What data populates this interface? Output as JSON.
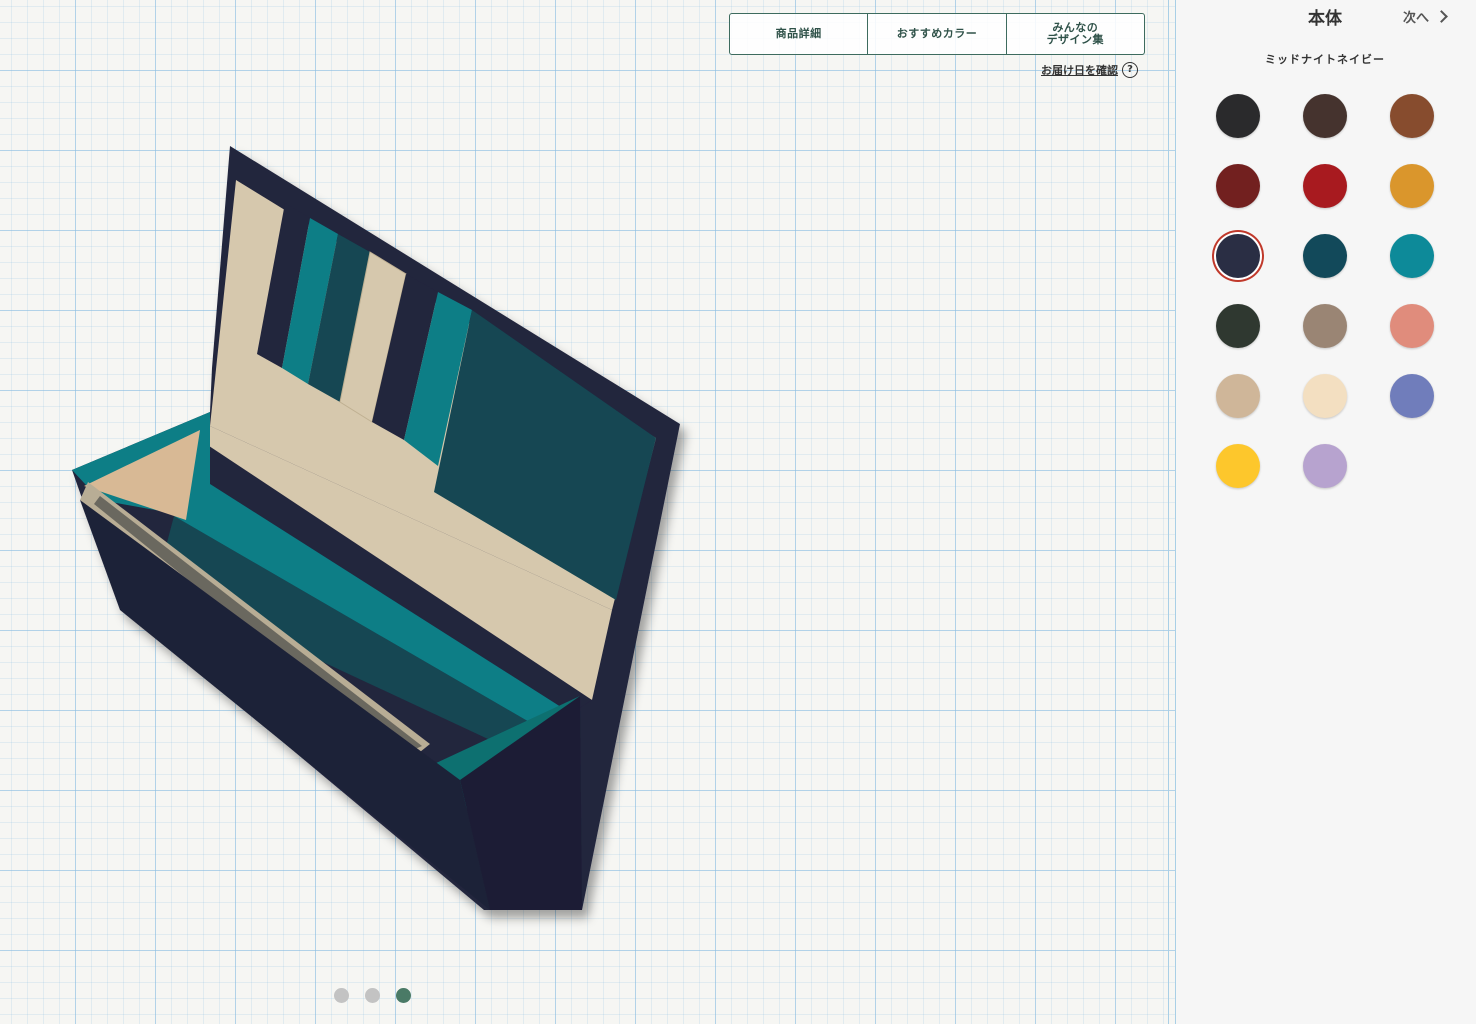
{
  "tabs": [
    {
      "label": "商品詳細"
    },
    {
      "label": "おすすめカラー"
    },
    {
      "label": "みんなの\nデザイン集"
    }
  ],
  "delivery": {
    "label": "お届け日を確認",
    "icon": "question-icon"
  },
  "carousel": {
    "count": 3,
    "active_index": 2
  },
  "panel": {
    "title": "本体",
    "next_label": "次へ",
    "selected_color_name": "ミッドナイトネイビー",
    "selected_index": 6,
    "swatches": [
      "#2a2a2c",
      "#45332e",
      "#874c2e",
      "#72201f",
      "#a81a1f",
      "#da962c",
      "#2a2e44",
      "#12495a",
      "#0d8a99",
      "#2f3830",
      "#9a8574",
      "#e08c7c",
      "#cfb699",
      "#f3dfc1",
      "#707dbb",
      "#fdc72c",
      "#b7a3cf"
    ]
  },
  "wallet_colors": {
    "body": "#22253e",
    "lining": "#d6c8ad",
    "accent_teal": "#0d7e86",
    "dark_teal": "#134652",
    "zipper": "#b8ad95"
  }
}
